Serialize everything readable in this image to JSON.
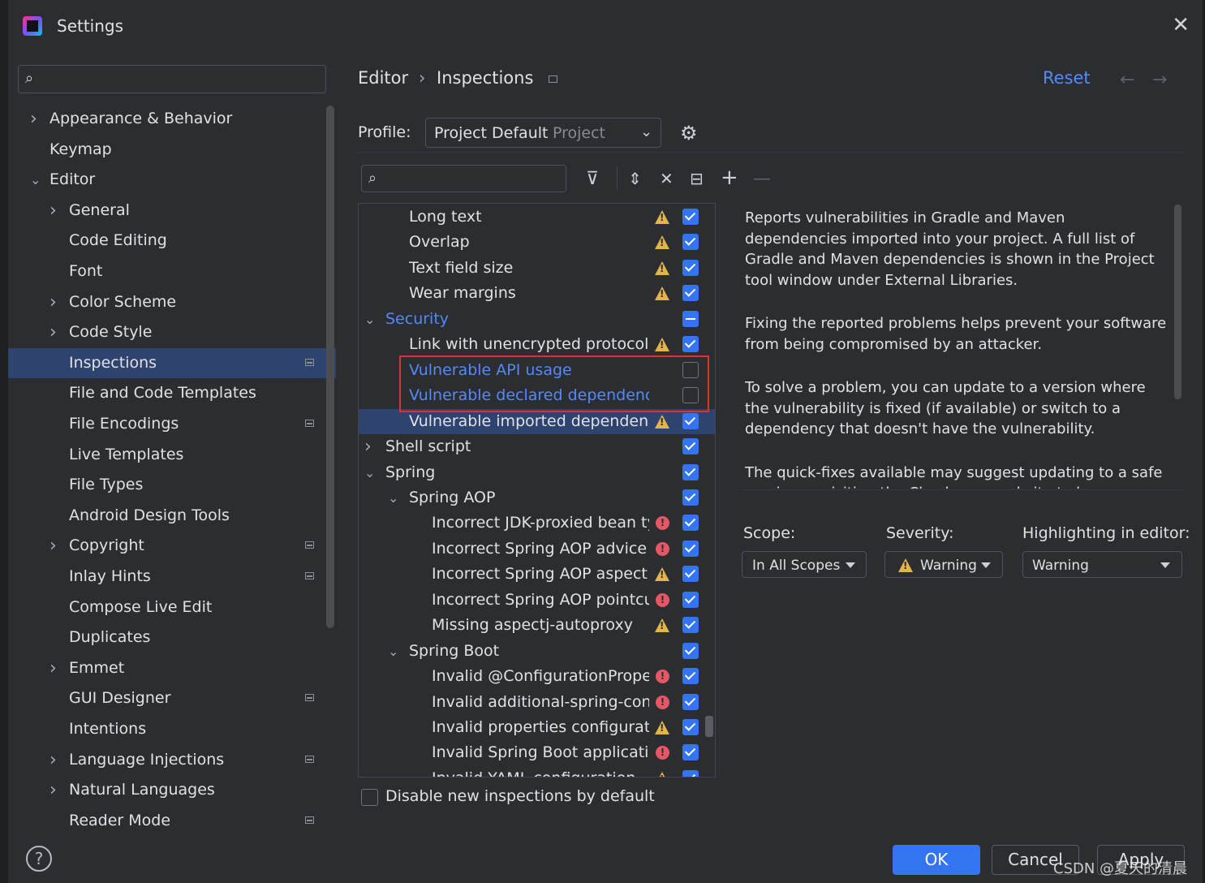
{
  "window": {
    "title": "Settings"
  },
  "search": {
    "placeholder": ""
  },
  "sidebar": {
    "items": [
      {
        "label": "Appearance & Behavior",
        "indent": 0,
        "expandable": true,
        "expanded": false,
        "project": false
      },
      {
        "label": "Keymap",
        "indent": 0,
        "expandable": false,
        "project": false
      },
      {
        "label": "Editor",
        "indent": 0,
        "expandable": true,
        "expanded": true,
        "project": false
      },
      {
        "label": "General",
        "indent": 1,
        "expandable": true,
        "expanded": false,
        "project": false
      },
      {
        "label": "Code Editing",
        "indent": 1,
        "expandable": false,
        "project": false
      },
      {
        "label": "Font",
        "indent": 1,
        "expandable": false,
        "project": false
      },
      {
        "label": "Color Scheme",
        "indent": 1,
        "expandable": true,
        "expanded": false,
        "project": false
      },
      {
        "label": "Code Style",
        "indent": 1,
        "expandable": true,
        "expanded": false,
        "project": false
      },
      {
        "label": "Inspections",
        "indent": 1,
        "expandable": false,
        "project": true,
        "selected": true
      },
      {
        "label": "File and Code Templates",
        "indent": 1,
        "expandable": false,
        "project": false
      },
      {
        "label": "File Encodings",
        "indent": 1,
        "expandable": false,
        "project": true
      },
      {
        "label": "Live Templates",
        "indent": 1,
        "expandable": false,
        "project": false
      },
      {
        "label": "File Types",
        "indent": 1,
        "expandable": false,
        "project": false
      },
      {
        "label": "Android Design Tools",
        "indent": 1,
        "expandable": false,
        "project": false
      },
      {
        "label": "Copyright",
        "indent": 1,
        "expandable": true,
        "expanded": false,
        "project": true
      },
      {
        "label": "Inlay Hints",
        "indent": 1,
        "expandable": false,
        "project": true
      },
      {
        "label": "Compose Live Edit",
        "indent": 1,
        "expandable": false,
        "project": false
      },
      {
        "label": "Duplicates",
        "indent": 1,
        "expandable": false,
        "project": false
      },
      {
        "label": "Emmet",
        "indent": 1,
        "expandable": true,
        "expanded": false,
        "project": false
      },
      {
        "label": "GUI Designer",
        "indent": 1,
        "expandable": false,
        "project": true
      },
      {
        "label": "Intentions",
        "indent": 1,
        "expandable": false,
        "project": false
      },
      {
        "label": "Language Injections",
        "indent": 1,
        "expandable": true,
        "expanded": false,
        "project": true
      },
      {
        "label": "Natural Languages",
        "indent": 1,
        "expandable": true,
        "expanded": false,
        "project": false
      },
      {
        "label": "Reader Mode",
        "indent": 1,
        "expandable": false,
        "project": true
      }
    ]
  },
  "header": {
    "breadcrumb_parent": "Editor",
    "breadcrumb_sep": "›",
    "breadcrumb_current": "Inspections",
    "reset_label": "Reset",
    "back_arrow": "←",
    "forward_arrow": "→"
  },
  "profile": {
    "label": "Profile:",
    "value": "Project Default",
    "scope_hint": "Project"
  },
  "toolbar": {
    "filter_search_placeholder": ""
  },
  "inspections": {
    "rows": [
      {
        "label": "Long text",
        "indent": 2,
        "severity": "warning",
        "state": "on"
      },
      {
        "label": "Overlap",
        "indent": 2,
        "severity": "warning",
        "state": "on"
      },
      {
        "label": "Text field size",
        "indent": 2,
        "severity": "warning",
        "state": "on"
      },
      {
        "label": "Wear margins",
        "indent": 2,
        "severity": "warning",
        "state": "on"
      },
      {
        "label": "Security",
        "indent": 1,
        "group": true,
        "expanded": true,
        "link": true,
        "state": "mixed"
      },
      {
        "label": "Link with unencrypted protocol",
        "indent": 2,
        "severity": "warning",
        "state": "on"
      },
      {
        "label": "Vulnerable API usage",
        "indent": 2,
        "link": true,
        "state": "off"
      },
      {
        "label": "Vulnerable declared dependency",
        "indent": 2,
        "link": true,
        "state": "off"
      },
      {
        "label": "Vulnerable imported dependency",
        "indent": 2,
        "severity": "warning",
        "state": "on",
        "selected": true
      },
      {
        "label": "Shell script",
        "indent": 1,
        "group": true,
        "expanded": false,
        "state": "on"
      },
      {
        "label": "Spring",
        "indent": 1,
        "group": true,
        "expanded": true,
        "state": "on"
      },
      {
        "label": "Spring AOP",
        "indent": 2,
        "group": true,
        "expanded": true,
        "state": "on"
      },
      {
        "label": "Incorrect JDK-proxied bean type",
        "indent": 3,
        "severity": "error",
        "state": "on"
      },
      {
        "label": "Incorrect Spring AOP advice or advisor",
        "indent": 3,
        "severity": "error",
        "state": "on"
      },
      {
        "label": "Incorrect Spring AOP aspect or introduction",
        "indent": 3,
        "severity": "warning",
        "state": "on"
      },
      {
        "label": "Incorrect Spring AOP pointcut expression",
        "indent": 3,
        "severity": "error",
        "state": "on"
      },
      {
        "label": "Missing aspectj-autoproxy",
        "indent": 3,
        "severity": "warning",
        "state": "on"
      },
      {
        "label": "Spring Boot",
        "indent": 2,
        "group": true,
        "expanded": true,
        "state": "on"
      },
      {
        "label": "Invalid @ConfigurationProperties",
        "indent": 3,
        "severity": "error",
        "state": "on"
      },
      {
        "label": "Invalid additional-spring-configuration-metadata.json",
        "indent": 3,
        "severity": "error",
        "state": "on"
      },
      {
        "label": "Invalid properties configuration",
        "indent": 3,
        "severity": "warning",
        "state": "on"
      },
      {
        "label": "Invalid Spring Boot application.properties",
        "indent": 3,
        "severity": "error",
        "state": "on"
      },
      {
        "label": "Invalid YAML configuration",
        "indent": 3,
        "severity": "warning",
        "state": "on"
      }
    ]
  },
  "description": {
    "paragraphs": [
      "Reports vulnerabilities in Gradle and Maven dependencies imported into your project. A full list of Gradle and Maven dependencies is shown in the Project tool window under External Libraries.",
      "Fixing the reported problems helps prevent your software from being compromised by an attacker.",
      "To solve a problem, you can update to a version where the vulnerability is fixed (if available) or switch to a dependency that doesn't have the vulnerability.",
      "The quick-fixes available may suggest updating to a safe version or visiting the Checkmarx website to learn more about a particular vulnerability."
    ]
  },
  "options": {
    "scope_label": "Scope:",
    "scope_value": "In All Scopes",
    "severity_label": "Severity:",
    "severity_value": "Warning",
    "highlight_label": "Highlighting in editor:",
    "highlight_value": "Warning"
  },
  "footer": {
    "disable_new_label": "Disable new inspections by default",
    "help": "?",
    "ok_label": "OK",
    "cancel_label": "Cancel",
    "apply_label": "Apply"
  },
  "watermark": "CSDN @夏天的清晨",
  "colors": {
    "accent": "#3574f0",
    "link": "#548af7",
    "selection": "#2e436e",
    "warning": "#e2b44b",
    "error": "#e55765",
    "annotation": "#e03030"
  }
}
